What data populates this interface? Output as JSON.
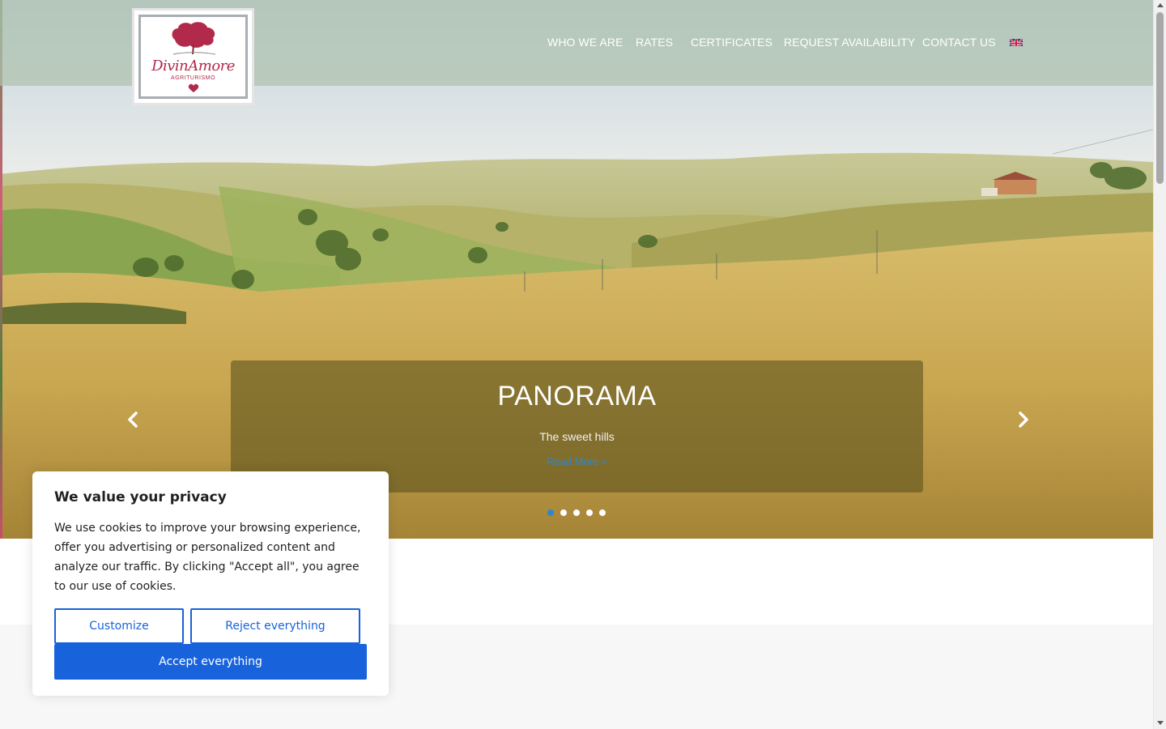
{
  "brand": {
    "logo_name": "DivinAmore",
    "logo_subtitle": "AGRITURISMO"
  },
  "nav": {
    "items": [
      {
        "label": "WHO WE ARE"
      },
      {
        "label": "RATES"
      },
      {
        "label": "CERTIFICATES"
      },
      {
        "label": "REQUEST AVAILABILITY"
      },
      {
        "label": "CONTACT US"
      }
    ],
    "language_icon": "uk-flag-icon"
  },
  "slider": {
    "title": "PANORAMA",
    "subtitle": "The sweet hills",
    "read_more": "Read More »",
    "slide_count": 5,
    "active_slide": 1,
    "prev_icon": "chevron-left-icon",
    "next_icon": "chevron-right-icon"
  },
  "cookie_banner": {
    "title": "We value your privacy",
    "message": "We use cookies to improve your browsing experience, offer you advertising or personalized content and analyze our traffic. By clicking \"Accept all\", you agree to our use of cookies.",
    "customize_label": "Customize",
    "reject_label": "Reject everything",
    "accept_label": "Accept everything"
  },
  "colors": {
    "accent": "#1863dc",
    "brand": "#b22a4b",
    "link": "#2f86c9"
  }
}
